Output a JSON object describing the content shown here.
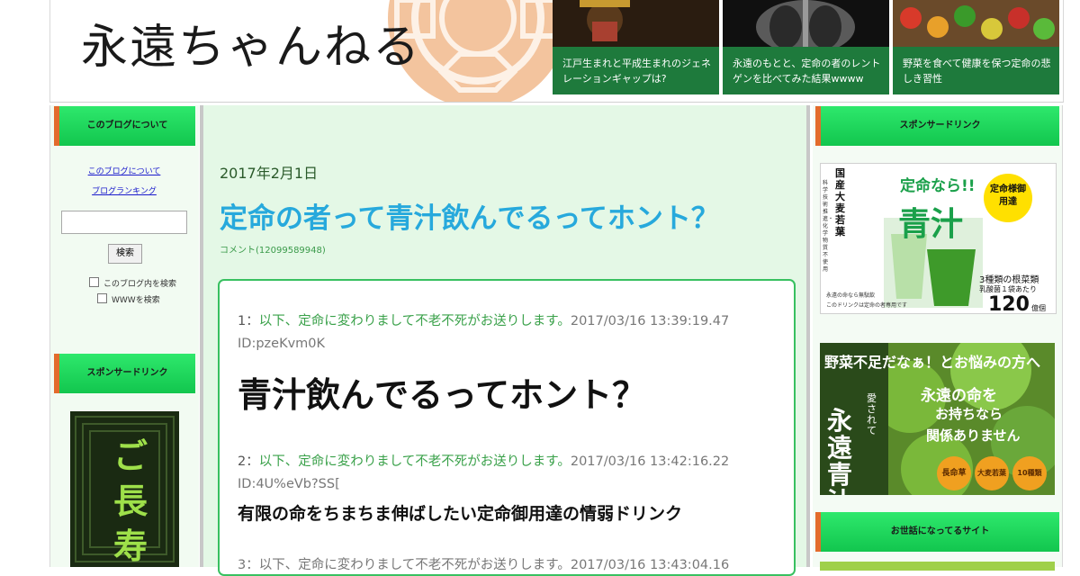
{
  "site": {
    "logo": "永遠ちゃんねる"
  },
  "features": [
    {
      "caption": "江戸生まれと平成生まれのジェネレーションギャップは?"
    },
    {
      "caption": "永遠のもとと、定命の者のレントゲンを比べてみた結果wwww"
    },
    {
      "caption": "野菜を食べて健康を保つ定命の悲しき習性"
    }
  ],
  "left": {
    "about_heading": "このブログについて",
    "links": [
      "このブログについて",
      "ブログランキング"
    ],
    "search": {
      "value": "",
      "button": "検索"
    },
    "options": [
      "このブログ内を検索",
      "WWWを検索"
    ],
    "sponsor_heading": "スポンサードリンク",
    "banner_text": "ご長寿"
  },
  "post": {
    "date": "2017年2月1日",
    "title": "定命の者って青汁飲んでるってホント？",
    "comments": "コメント(12099589948)",
    "responses": [
      {
        "num": "1",
        "name": "以下、定命に変わりまして不老不死がお送りします。",
        "datetime": "2017/03/16 13:39:19.47",
        "id": "ID:pzeKvm0K",
        "body": "青汁飲んでるってホント？"
      },
      {
        "num": "2",
        "name": "以下、定命に変わりまして不老不死がお送りします。",
        "datetime": "2017/03/16 13:42:16.22",
        "id": "ID:4U%eVb?SS[",
        "body": "有限の命をちまちま伸ばしたい定命御用達の情弱ドリンク"
      }
    ],
    "third_fragment": "3：以下、定命に変わりまして不老不死がお送りします。2017/03/16 13:43:04.16"
  },
  "right": {
    "sponsor_heading": "スポンサードリンク",
    "ad1": {
      "vertical1": "国産大麦若葉",
      "vertical2": "科学技術推進・化学物質不使用",
      "headline": "定命なら!!",
      "product": "青汁",
      "badge": "定命様御用達",
      "note1": "3種類の根菜類",
      "note2": "乳酸菌１袋あたり",
      "count": "120",
      "unit": "億個",
      "fine": "永遠の命なら無駄飲",
      "fine2": "このドリンクは定命の者専用です"
    },
    "ad2": {
      "headline": "野菜不足だなぁ！とお悩みの方へ",
      "vertical_small": "愛されて",
      "vertical_big": "永遠青汁",
      "msg1": "永遠の命を",
      "msg2": "お持ちなら",
      "msg3": "関係ありません",
      "pills": [
        "長命草",
        "大麦若葉",
        "10種類"
      ]
    },
    "friends_heading": "お世話になってるサイト"
  },
  "colors": {
    "header_green": "#1e7a3c",
    "title_blue": "#27a9dc",
    "sidebar_green": "#12c64e",
    "sidebar_accent": "#e36b2c"
  }
}
